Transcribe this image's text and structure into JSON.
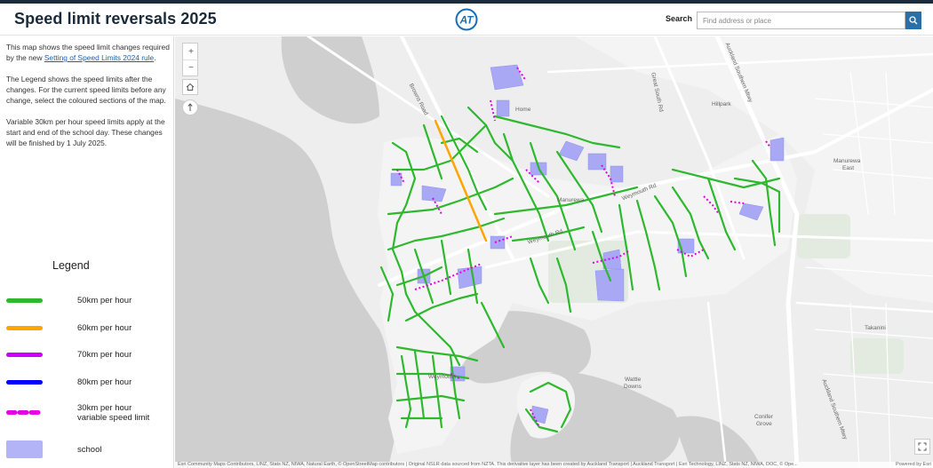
{
  "header": {
    "title": "Speed limit reversals 2025",
    "search_label": "Search",
    "search_placeholder": "Find address or place",
    "search_value": ""
  },
  "sidebar": {
    "paragraph1_prefix": "This map shows the speed limit changes required by the new ",
    "paragraph1_link": "Setting of Speed Limits 2024 rule",
    "paragraph1_suffix": ".",
    "paragraph2": "The Legend shows the speed limits after the changes. For the current speed limits before any change, select the coloured sections of the map.",
    "paragraph3": "Variable 30km per hour speed limits apply at the start and end of the school day. These changes will be finished by 1 July 2025."
  },
  "legend": {
    "title": "Legend",
    "items": [
      {
        "label": "50km per hour",
        "color": "#2eb82e",
        "style": "solid"
      },
      {
        "label": "60km per hour",
        "color": "#ffa500",
        "style": "solid"
      },
      {
        "label": "70km per hour",
        "color": "#cc00ff",
        "style": "solid"
      },
      {
        "label": "80km per hour",
        "color": "#0000ff",
        "style": "solid"
      },
      {
        "label": "30km per hour\nvariable speed limit",
        "color": "#e600e6",
        "style": "dashed"
      },
      {
        "label": "school",
        "color": "#b3b3f7",
        "style": "fill"
      }
    ]
  },
  "map": {
    "zoom_in": "+",
    "zoom_out": "−",
    "place_labels": {
      "hillpark": "Hillpark",
      "manurewa_east_1": "Manurewa",
      "manurewa_east_2": "East",
      "takanini": "Takanini",
      "wattle_downs_1": "Wattle",
      "wattle_downs_2": "Downs",
      "conifer_grove_1": "Conifer",
      "conifer_grove_2": "Grove",
      "home": "Home",
      "manurewa": "Manurewa",
      "weymouth": "Weymouth"
    },
    "road_labels": {
      "browns_road": "Browns Road",
      "great_south_rd": "Great South Rd",
      "southern_mwy_top": "Auckland Southern Mtwy",
      "southern_mwy_bottom": "Auckland Southern Mtwy",
      "weymouth_rd_1": "Weymouth Rd",
      "weymouth_rd_2": "Weymouth Rd"
    },
    "attribution": "Esri Community Maps Contributors, LINZ, Stats NZ, NIWA, Natural Earth, © OpenStreetMap contributors | Original NSLR data sourced from NZTA. This derivative layer has been created by Auckland Transport | Auckland Transport | Esri Technology, LINZ, Stats NZ, NIWA, DOC, © Ope...",
    "powered_by": "Powered by Esri"
  }
}
